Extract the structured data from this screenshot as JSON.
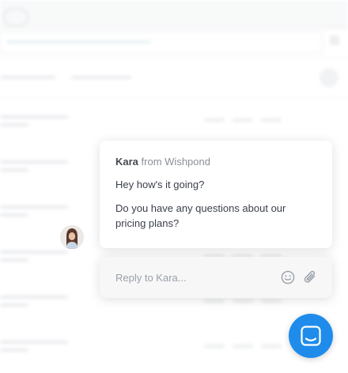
{
  "conversation": {
    "sender_name": "Kara",
    "sender_org": "from Wishpond",
    "messages": [
      "Hey how's it going?",
      "Do you have any questions about our pricing plans?"
    ]
  },
  "reply": {
    "placeholder": "Reply to Kara..."
  },
  "icons": {
    "emoji": "smiley-face-icon",
    "attachment": "paperclip-icon",
    "launcher": "chat-bubble-icon"
  },
  "colors": {
    "launcher": "#1f8ceb",
    "card_background": "#ffffff",
    "reply_background": "#f7f7f8",
    "text": "#3a3f4a",
    "muted_text": "#8a8f98"
  }
}
